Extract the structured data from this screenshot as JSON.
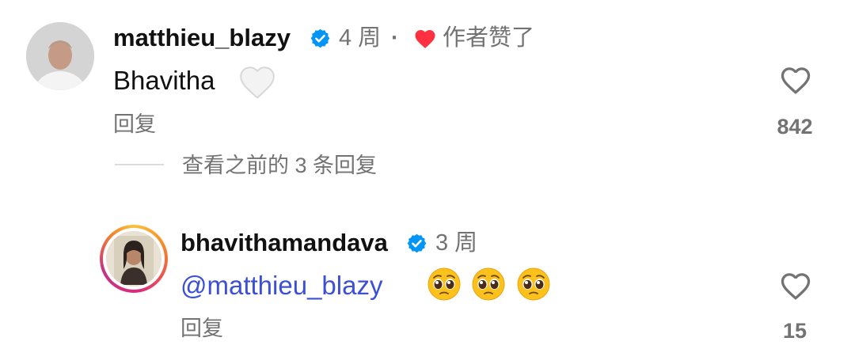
{
  "comments": [
    {
      "username": "matthieu_blazy",
      "time": "4 周",
      "separator": "·",
      "author_liked": "作者赞了",
      "text": "Bhavitha",
      "reply_label": "回复",
      "like_count": "842",
      "view_replies": "查看之前的 3 条回复"
    },
    {
      "username": "bhavithamandava",
      "time": "3 周",
      "mention": "@matthieu_blazy",
      "emoji": "pleading-face",
      "reply_label": "回复",
      "like_count": "15"
    }
  ],
  "colors": {
    "verified": "#0095f6",
    "liked_heart": "#ff3040",
    "mention": "#3b50d6",
    "secondary_text": "#737373"
  }
}
